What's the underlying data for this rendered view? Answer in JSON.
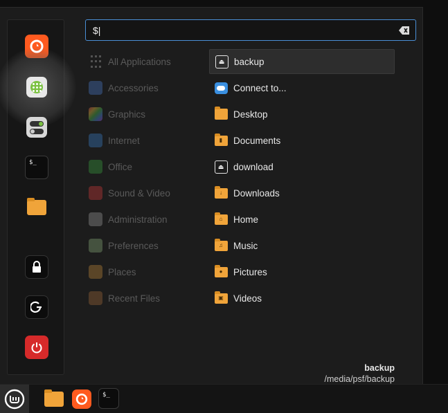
{
  "search": {
    "value": "$|",
    "placeholder": ""
  },
  "favorites": [
    {
      "name": "firefox-icon"
    },
    {
      "name": "software-manager-icon"
    },
    {
      "name": "system-settings-icon"
    },
    {
      "name": "terminal-icon",
      "glyph": "$_"
    },
    {
      "name": "file-manager-icon"
    },
    {
      "name": "lock-screen-icon"
    },
    {
      "name": "logout-icon"
    },
    {
      "name": "shutdown-icon"
    }
  ],
  "categories": [
    {
      "label": "All Applications"
    },
    {
      "label": "Accessories"
    },
    {
      "label": "Graphics"
    },
    {
      "label": "Internet"
    },
    {
      "label": "Office"
    },
    {
      "label": "Sound & Video"
    },
    {
      "label": "Administration"
    },
    {
      "label": "Preferences"
    },
    {
      "label": "Places"
    },
    {
      "label": "Recent Files"
    }
  ],
  "results": [
    {
      "label": "backup",
      "icon": "drive-eject-icon"
    },
    {
      "label": "Connect to...",
      "icon": "network-cloud-icon"
    },
    {
      "label": "Desktop",
      "icon": "folder-desktop-icon"
    },
    {
      "label": "Documents",
      "icon": "folder-documents-icon"
    },
    {
      "label": "download",
      "icon": "drive-eject-icon"
    },
    {
      "label": "Downloads",
      "icon": "folder-downloads-icon"
    },
    {
      "label": "Home",
      "icon": "folder-home-icon"
    },
    {
      "label": "Music",
      "icon": "folder-music-icon"
    },
    {
      "label": "Pictures",
      "icon": "folder-pictures-icon"
    },
    {
      "label": "Videos",
      "icon": "folder-videos-icon"
    }
  ],
  "info": {
    "name": "backup",
    "path": "/media/psf/backup"
  },
  "taskbar": {
    "terminal_glyph": "$_"
  },
  "colors": {
    "accent": "#4a8fd6",
    "folder": "#f0a43a",
    "firefox": "#ff5a1f",
    "shutdown": "#d62a2a"
  }
}
